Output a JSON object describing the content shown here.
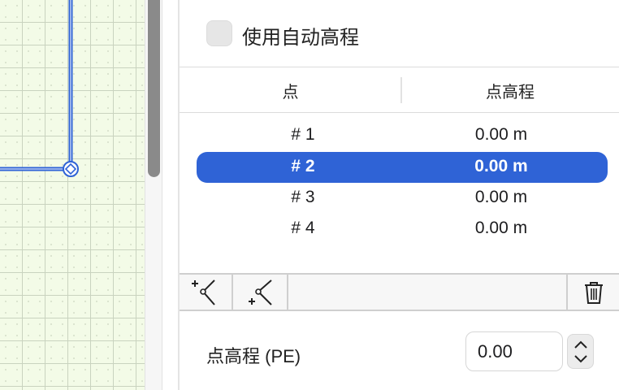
{
  "canvas": {
    "background_color": "#f3fbe7",
    "line_color": "#2f63d6"
  },
  "auto_elevation": {
    "label": "使用自动高程",
    "checked": false
  },
  "table": {
    "columns": [
      "点",
      "点高程"
    ],
    "rows": [
      {
        "point": "# 1",
        "elevation": "0.00 m",
        "selected": false
      },
      {
        "point": "# 2",
        "elevation": "0.00 m",
        "selected": true
      },
      {
        "point": "# 3",
        "elevation": "0.00 m",
        "selected": false
      },
      {
        "point": "# 4",
        "elevation": "0.00 m",
        "selected": false
      }
    ],
    "selection_color": "#2f63d6"
  },
  "toolbar": {
    "add_before_icon": "insert-point-before-icon",
    "add_after_icon": "insert-point-after-icon",
    "delete_icon": "trash-icon"
  },
  "point_elevation": {
    "label": "点高程 (PE)",
    "value": "0.00"
  }
}
